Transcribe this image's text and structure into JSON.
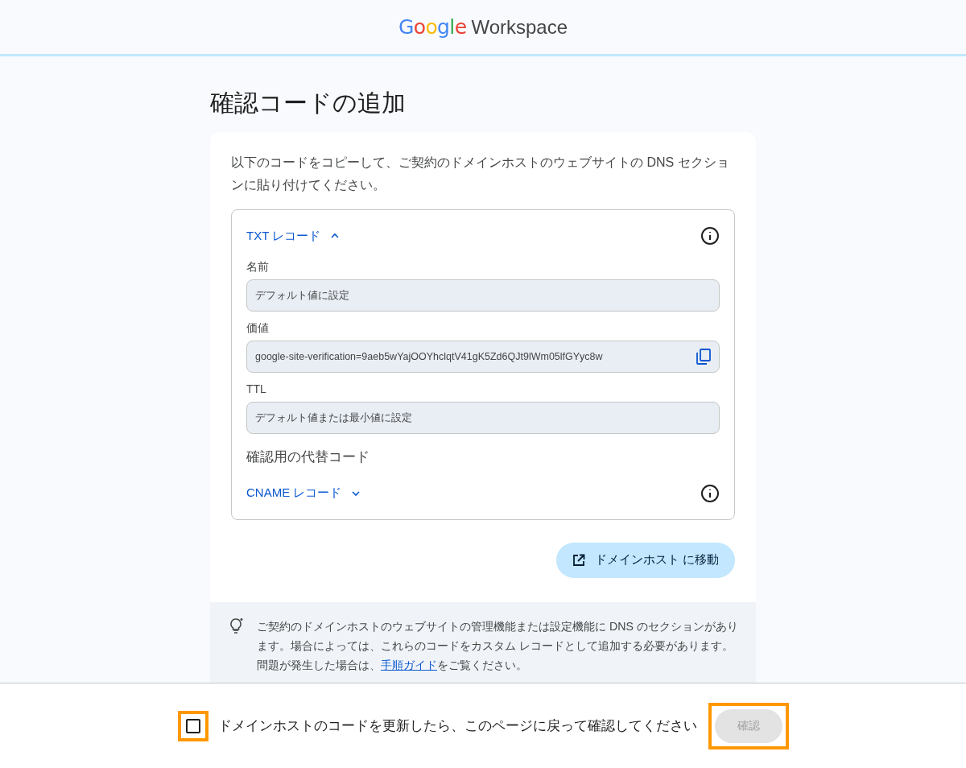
{
  "header": {
    "logo": {
      "brand": "Google",
      "product": "Workspace"
    }
  },
  "title": "確認コードの追加",
  "instruction": "以下のコードをコピーして、ご契約のドメインホストのウェブサイトの DNS セクションに貼り付けてください。",
  "txt_record": {
    "label": "TXT レコード",
    "expanded": true,
    "fields": [
      {
        "label": "名前",
        "value": "デフォルト値に設定",
        "copyable": false
      },
      {
        "label": "価値",
        "value": "google-site-verification=9aeb5wYajOOYhclqtV41gK5Zd6QJt9lWm05lfGYyc8w",
        "copyable": true
      },
      {
        "label": "TTL",
        "value": "デフォルト値または最小値に設定",
        "copyable": false
      }
    ]
  },
  "alternative_heading": "確認用の代替コード",
  "cname_record": {
    "label": "CNAME レコード",
    "expanded": false
  },
  "go_button": "ドメインホスト に移動",
  "hint": {
    "before": "ご契約のドメインホストのウェブサイトの管理機能または設定機能に DNS のセクションがあります。場合によっては、これらのコードをカスタム レコードとして追加する必要があります。問題が発生した場合は、",
    "link": "手順ガイド",
    "after": "をご覧ください。"
  },
  "footer": {
    "checkbox": {
      "label": "ドメインホストのコードを更新したら、このページに戻って確認してください",
      "checked": false,
      "highlighted": true
    },
    "confirm_button": {
      "label": "確認",
      "disabled": true,
      "highlighted": true
    }
  }
}
